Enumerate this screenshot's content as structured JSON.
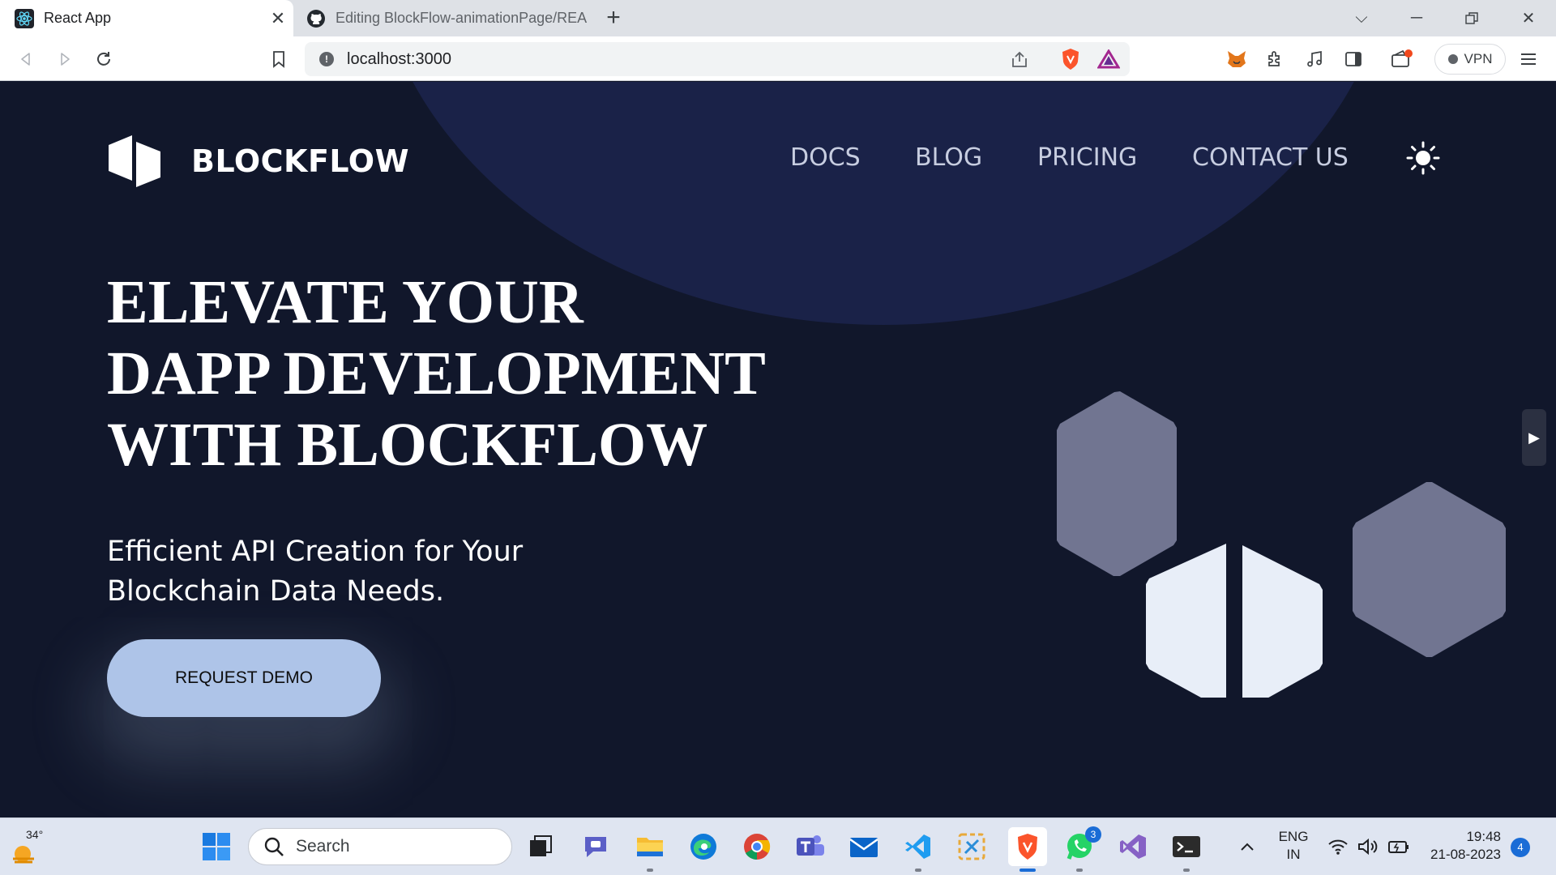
{
  "browser": {
    "tabs": [
      {
        "title": "React App",
        "favicon": "react-icon",
        "active": true
      },
      {
        "title": "Editing BlockFlow-animationPage/REA",
        "favicon": "github-icon",
        "active": false
      }
    ],
    "url": "localhost:3000",
    "vpn_label": "VPN"
  },
  "site": {
    "brand": "BLOCKFLOW",
    "nav": [
      "DOCS",
      "BLOG",
      "PRICING",
      "CONTACT US"
    ],
    "hero": {
      "title_lines": [
        "ELEVATE YOUR",
        "DAPP DEVELOPMENT",
        "WITH BLOCKFLOW"
      ],
      "subtitle_lines": [
        "Efficient API Creation for Your",
        "Blockchain Data Needs."
      ],
      "cta": "REQUEST DEMO"
    },
    "colors": {
      "background": "#11172b",
      "circle": "#1a2248",
      "cta": "#aec4e8",
      "hex_grey": "#717591",
      "hex_white": "#e8eef8"
    }
  },
  "taskbar": {
    "weather_temp": "34°",
    "search_placeholder": "Search",
    "whatsapp_badge": "3",
    "language": [
      "ENG",
      "IN"
    ],
    "time": "19:48",
    "date": "21-08-2023",
    "notification_count": "4"
  }
}
